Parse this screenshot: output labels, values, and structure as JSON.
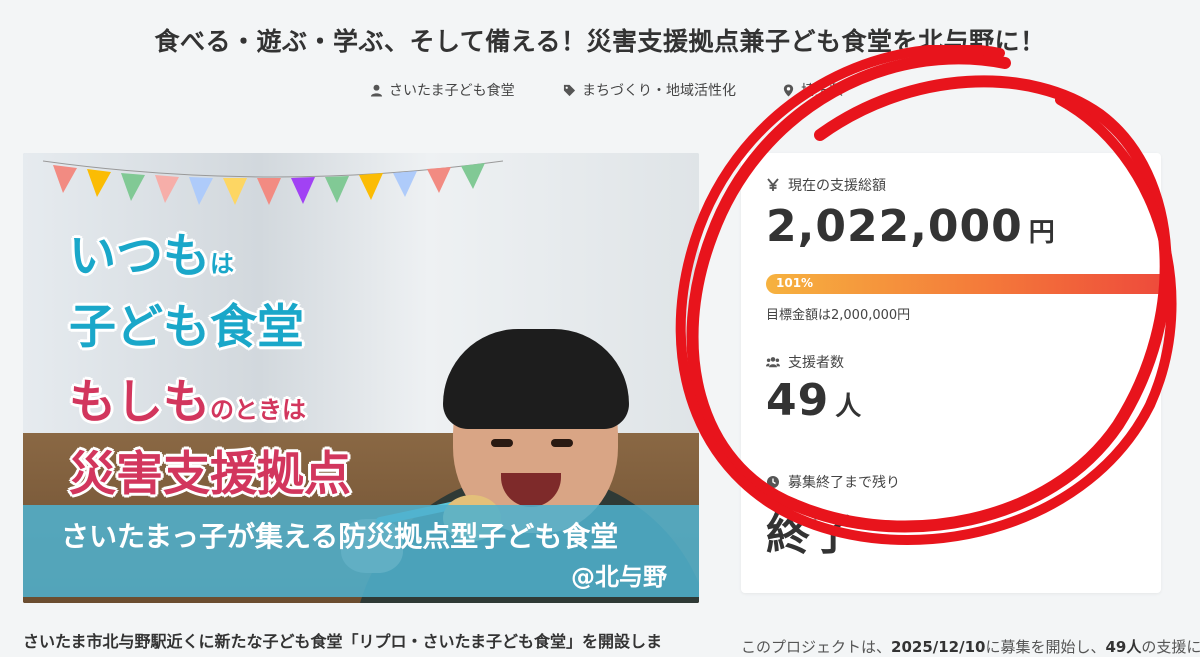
{
  "page": {
    "title": "食べる・遊ぶ・学ぶ、そして備える！災害支援拠点兼子ども食堂を北与野に！"
  },
  "meta": {
    "author": "さいたま子ども食堂",
    "category": "まちづくり・地域活性化",
    "location": "埼玉県"
  },
  "hero": {
    "line1_main": "いつも",
    "line1_small": "は",
    "line2": "子ども食堂",
    "line3_main": "もしも",
    "line3_small": "のときは",
    "line4": "災害支援拠点",
    "band_line1": "さいたまっ子が集える防災拠点型子ども食堂",
    "band_line2": "@北与野"
  },
  "funding": {
    "total_label": "現在の支援総額",
    "total_amount": "2,022,000",
    "total_unit": "円",
    "progress_text": "101%",
    "progress_percent": 101,
    "goal_text": "目標金額は2,000,000円",
    "supporters_label": "支援者数",
    "supporters_count": "49",
    "supporters_unit": "人",
    "remaining_label": "募集終了まで残り",
    "remaining_value": "終了"
  },
  "description": {
    "left": "さいたま市北与野駅近くに新たな子ども食堂「リプロ・さいたま子ども食堂」を開設しま",
    "right_prefix": "このプロジェクトは、",
    "right_date": "2025/12/10",
    "right_mid": "に募集を開始し、",
    "right_count": "49人",
    "right_suffix": "の支援によ"
  },
  "colors": {
    "accent_cyan": "#1aa7c9",
    "accent_pink": "#d2365d",
    "progress_start": "#f6b23f",
    "progress_end": "#ee4b3b",
    "annotation_red": "#e8141c"
  }
}
